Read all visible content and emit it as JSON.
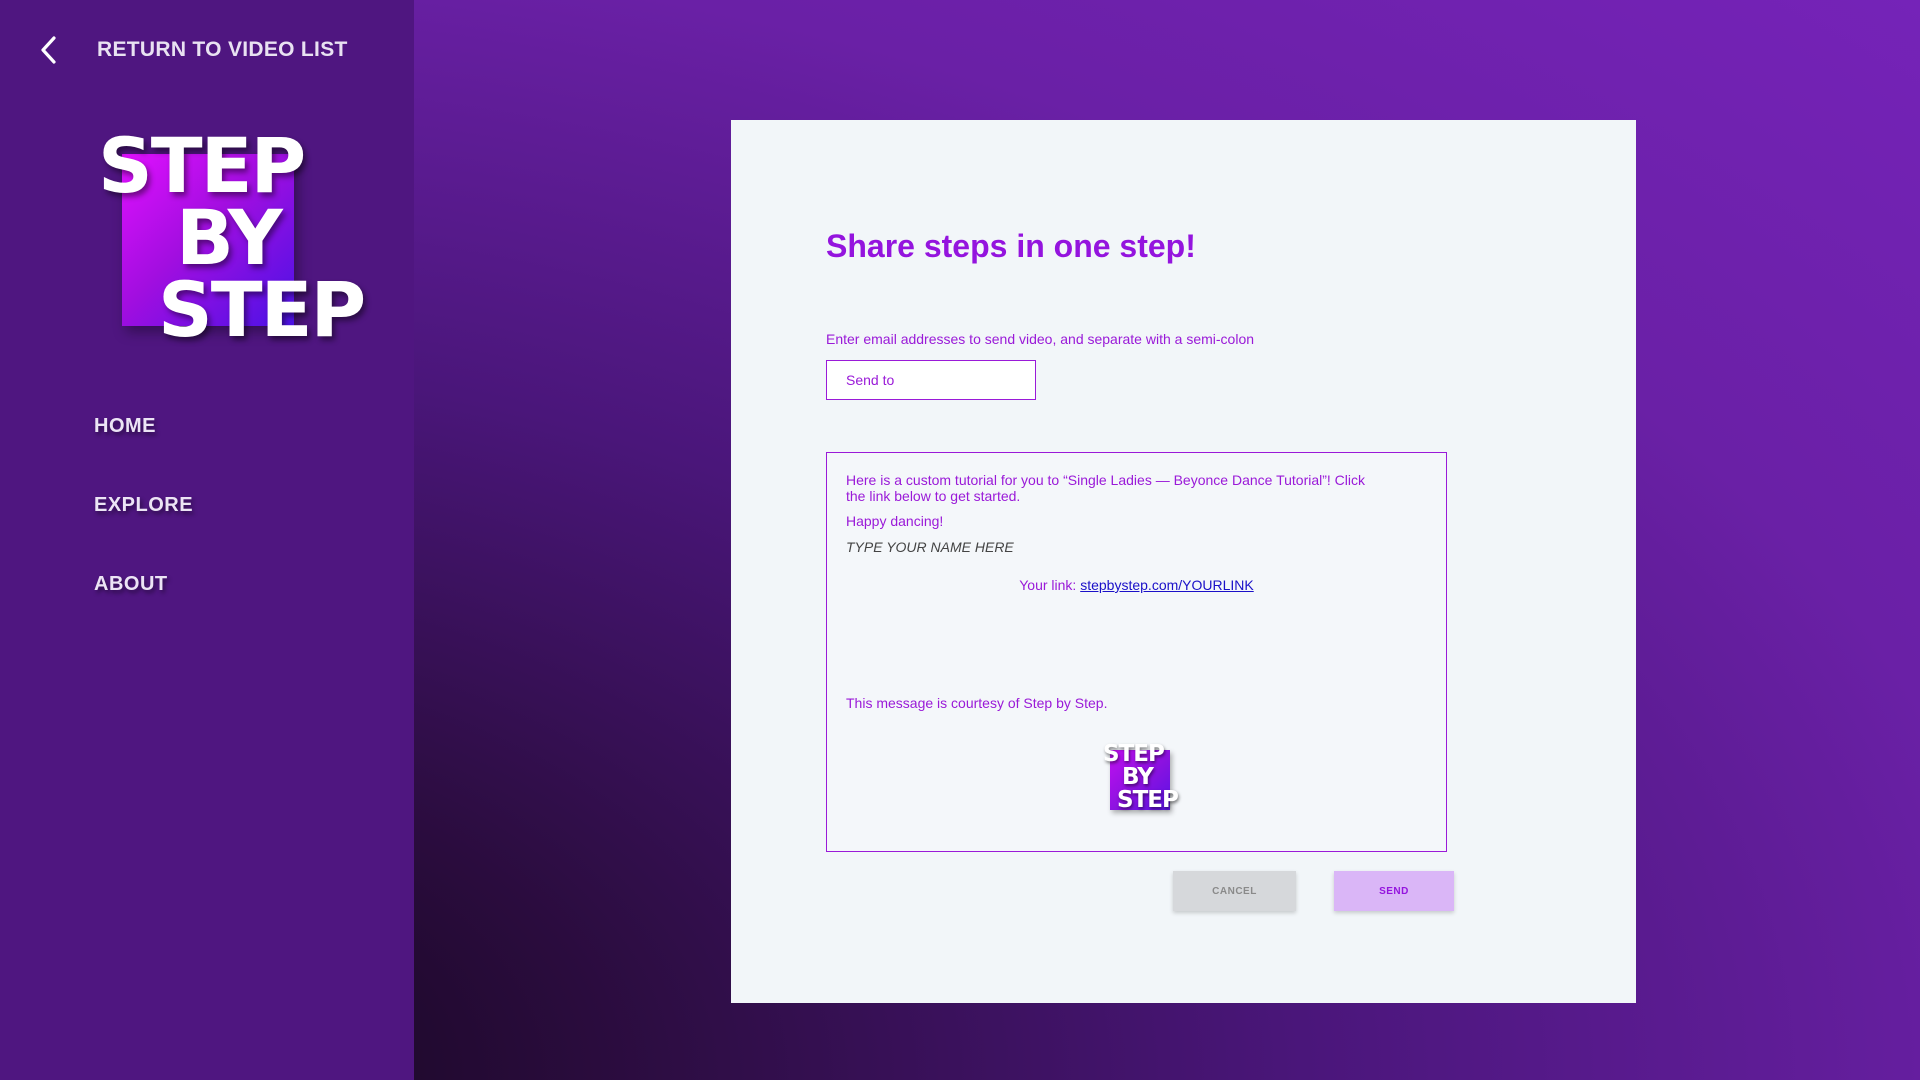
{
  "sidebar": {
    "return_label": "RETURN TO VIDEO LIST",
    "back_icon": "chevron-left-icon",
    "logo": {
      "words": [
        "STEP",
        "BY",
        "STEP"
      ],
      "square_gradient": [
        "#e010ff",
        "#4a12e6"
      ]
    },
    "nav": {
      "home": "HOME",
      "explore": "EXPLORE",
      "about": "ABOUT"
    },
    "background": "#4f1680"
  },
  "dialog": {
    "title": "Share steps in one step!",
    "instruction": "Enter email addresses to send video, and separate with a semi-colon",
    "send_to": {
      "placeholder": "Send to",
      "value": ""
    },
    "message": {
      "intro": "Here is a custom tutorial for you to “Single Ladies — Beyonce Dance Tutorial”! Click the link below to get started.",
      "happy": "Happy dancing!",
      "name_placeholder": "TYPE YOUR NAME HERE",
      "link_prefix": "Your link: ",
      "link_text": "stepbystep.com/YOURLINK",
      "courtesy": "This message is courtesy of Step by Step.",
      "logo_words": [
        "STEP",
        "BY",
        "STEP"
      ]
    },
    "buttons": {
      "cancel": "CANCEL",
      "send": "SEND"
    }
  },
  "colors": {
    "accent": "#9414de",
    "link": "#1a10c8",
    "card_background": "#f2f6f9",
    "send_button": "#dab6f7",
    "cancel_button": "#d6d8db"
  }
}
